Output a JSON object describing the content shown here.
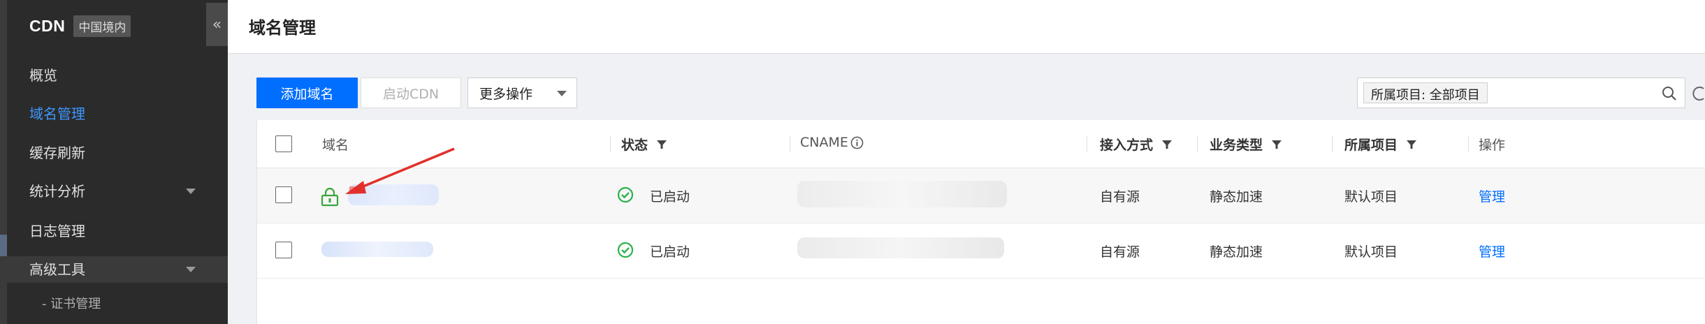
{
  "sidebar": {
    "brand": "CDN",
    "region_badge": "中国境内",
    "collapse_icon": "«",
    "items": [
      {
        "label": "概览"
      },
      {
        "label": "域名管理"
      },
      {
        "label": "缓存刷新"
      },
      {
        "label": "统计分析"
      },
      {
        "label": "日志管理"
      },
      {
        "label": "高级工具"
      }
    ],
    "sub_item": "- 证书管理"
  },
  "header": {
    "title": "域名管理"
  },
  "toolbar": {
    "add_domain": "添加域名",
    "enable_cdn": "启动CDN",
    "more_actions": "更多操作"
  },
  "search": {
    "tag": "所属项目: 全部项目"
  },
  "table": {
    "columns": {
      "domain": "域名",
      "status": "状态",
      "cname": "CNAME",
      "access": "接入方式",
      "service": "业务类型",
      "project": "所属项目",
      "ops": "操作"
    },
    "rows": [
      {
        "status": "已启动",
        "access": "自有源",
        "service": "静态加速",
        "project": "默认项目",
        "action": "管理"
      },
      {
        "status": "已启动",
        "access": "自有源",
        "service": "静态加速",
        "project": "默认项目",
        "action": "管理"
      }
    ]
  },
  "colors": {
    "accent": "#006eff",
    "sidebar_bg": "#2b2b2b",
    "active_nav": "#3e97ff",
    "status_ok": "#2ab34a",
    "annotation_arrow": "#e2302c"
  }
}
